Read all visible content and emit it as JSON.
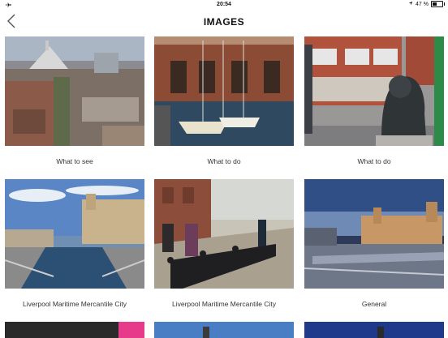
{
  "status": {
    "time": "20:54",
    "battery": "47 %",
    "battery_level": 0.47
  },
  "header": {
    "title": "IMAGES"
  },
  "tiles": [
    {
      "caption": "What to see"
    },
    {
      "caption": "What to do"
    },
    {
      "caption": "What to do"
    },
    {
      "caption": "Liverpool Maritime Mercantile City"
    },
    {
      "caption": "Liverpool Maritime Mercantile City"
    },
    {
      "caption": "General"
    }
  ],
  "icons": [
    "airplane-icon",
    "location-icon",
    "battery-icon",
    "back-chevron-icon"
  ]
}
